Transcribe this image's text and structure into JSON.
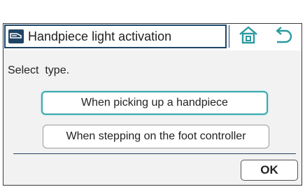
{
  "header": {
    "title": "Handpiece light activation",
    "title_icon": "handpiece-icon",
    "home_icon": "home-icon",
    "back_icon": "back-arrow-icon"
  },
  "main": {
    "prompt": "Select  type.",
    "options": [
      {
        "label": "When picking up a handpiece",
        "selected": true
      },
      {
        "label": "When stepping on the foot controller",
        "selected": false
      }
    ],
    "ok_label": "OK"
  },
  "colors": {
    "accent": "#1f4566",
    "selected_border": "#3aa8ad",
    "icon_teal": "#2a9aa0"
  }
}
